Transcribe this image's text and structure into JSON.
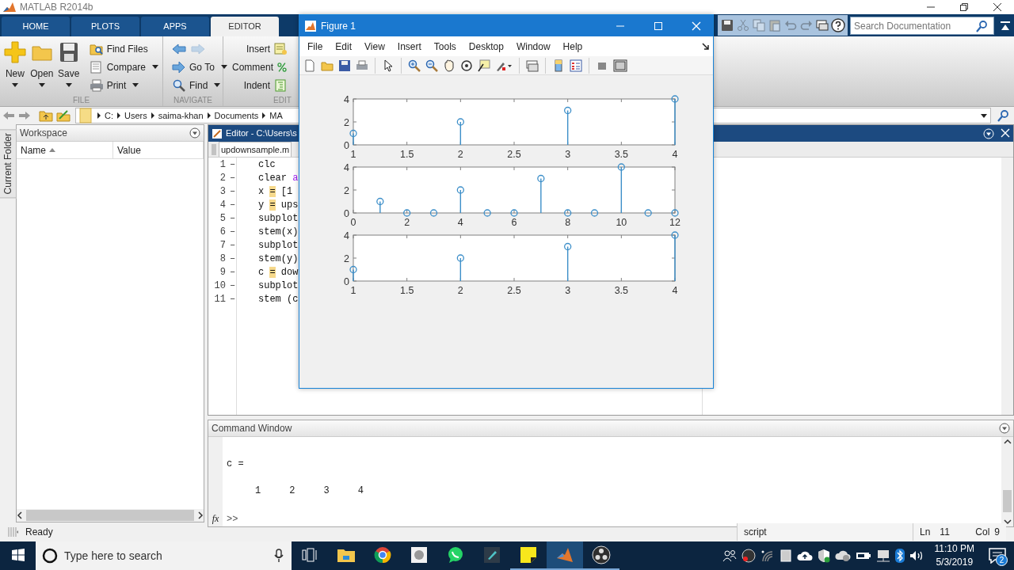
{
  "window": {
    "title": "MATLAB R2014b"
  },
  "toolstrip_tabs": [
    {
      "label": "HOME",
      "selected": false
    },
    {
      "label": "PLOTS",
      "selected": false
    },
    {
      "label": "APPS",
      "selected": false
    },
    {
      "label": "EDITOR",
      "selected": true
    }
  ],
  "quick_access": [
    {
      "disabled": false
    },
    {
      "disabled": true
    },
    {
      "disabled": true
    },
    {
      "disabled": true
    },
    {
      "disabled": true
    },
    {
      "disabled": true
    },
    {
      "disabled": false
    },
    {
      "disabled": false
    }
  ],
  "search": {
    "placeholder": "Search Documentation"
  },
  "ribbon_sections": [
    {
      "title": "FILE",
      "columns": [
        {
          "kind": "large",
          "label": "New",
          "dropdown": true
        },
        {
          "kind": "large",
          "label": "Open",
          "dropdown": true
        },
        {
          "kind": "large",
          "label": "Save",
          "dropdown": true
        },
        {
          "kind": "stack",
          "rows": [
            {
              "kind": "button",
              "label": "Find Files",
              "dropdown": false
            },
            {
              "kind": "button",
              "label": "Compare",
              "dropdown": true
            },
            {
              "kind": "button",
              "label": "Print",
              "dropdown": true
            }
          ]
        }
      ]
    },
    {
      "title": "NAVIGATE",
      "columns": [
        {
          "kind": "stack",
          "rows": [
            {
              "kind": "history",
              "back_disabled": false,
              "forward_disabled": true
            },
            {
              "kind": "button",
              "label": "Go To",
              "dropdown": true
            },
            {
              "kind": "button",
              "label": "Find",
              "dropdown": true
            }
          ]
        }
      ]
    },
    {
      "title": "EDIT",
      "columns": [
        {
          "kind": "stack",
          "rows": [
            {
              "kind": "trailing",
              "label": "Insert",
              "dropdown": false
            },
            {
              "kind": "trailing",
              "label": "Comment",
              "dropdown": false
            },
            {
              "kind": "trailing",
              "label": "Indent",
              "dropdown": false
            }
          ]
        }
      ]
    }
  ],
  "address_bar": {
    "path": [
      "C:",
      "Users",
      "saima-khan",
      "Documents",
      "MA"
    ]
  },
  "side_tab": {
    "label": "Current Folder"
  },
  "workspace": {
    "title": "Workspace",
    "columns": [
      {
        "label": "Name",
        "sorted": true
      },
      {
        "label": "Value",
        "sorted": false
      }
    ]
  },
  "editor": {
    "title": "Editor - C:\\Users\\s",
    "tabs": [
      {
        "label": "updownsample.m",
        "selected": true
      }
    ],
    "lines": [
      {
        "number": "1",
        "marker": "–",
        "code": [
          {
            "kind": "plain",
            "text": "clc"
          }
        ]
      },
      {
        "number": "2",
        "marker": "–",
        "code": [
          {
            "kind": "plain",
            "text": "clear "
          },
          {
            "kind": "string",
            "text": "a"
          }
        ]
      },
      {
        "number": "3",
        "marker": "–",
        "code": [
          {
            "kind": "plain",
            "text": "x "
          },
          {
            "kind": "warning",
            "text": "="
          },
          {
            "kind": "plain",
            "text": " [1"
          }
        ]
      },
      {
        "number": "4",
        "marker": "–",
        "code": [
          {
            "kind": "plain",
            "text": "y "
          },
          {
            "kind": "warning",
            "text": "="
          },
          {
            "kind": "plain",
            "text": " ups"
          }
        ]
      },
      {
        "number": "5",
        "marker": "–",
        "code": [
          {
            "kind": "plain",
            "text": "subplot"
          }
        ]
      },
      {
        "number": "6",
        "marker": "–",
        "code": [
          {
            "kind": "plain",
            "text": "stem(x)"
          }
        ]
      },
      {
        "number": "7",
        "marker": "–",
        "code": [
          {
            "kind": "plain",
            "text": "subplot"
          }
        ]
      },
      {
        "number": "8",
        "marker": "–",
        "code": [
          {
            "kind": "plain",
            "text": "stem(y)"
          }
        ]
      },
      {
        "number": "9",
        "marker": "–",
        "code": [
          {
            "kind": "plain",
            "text": "c "
          },
          {
            "kind": "warning",
            "text": "="
          },
          {
            "kind": "plain",
            "text": " dow"
          }
        ]
      },
      {
        "number": "10",
        "marker": "–",
        "code": [
          {
            "kind": "plain",
            "text": "subplot"
          }
        ]
      },
      {
        "number": "11",
        "marker": "–",
        "code": [
          {
            "kind": "plain",
            "text": "stem (c"
          }
        ]
      }
    ]
  },
  "command_window": {
    "title": "Command Window",
    "output": [
      "c =",
      "     1     2     3     4"
    ],
    "function_icon": "fx",
    "prompt": ">>"
  },
  "status_bar": {
    "status": "Ready",
    "file_type": "script",
    "line_label": "Ln",
    "line": "11",
    "column_label": "Col",
    "column": "9"
  },
  "figure": {
    "title": "Figure 1",
    "menu": [
      "File",
      "Edit",
      "View",
      "Insert",
      "Tools",
      "Desktop",
      "Window",
      "Help"
    ],
    "plots": [
      {
        "chart_data": {
          "type": "bar",
          "x": [
            1,
            2,
            3,
            4
          ],
          "series": [
            {
              "color": "#3d8fc9",
              "values": [
                1,
                2,
                3,
                4
              ]
            }
          ],
          "xlim": [
            1,
            4
          ],
          "ylim": [
            0,
            4
          ],
          "xticks": [
            1,
            1.5,
            2,
            2.5,
            3,
            3.5,
            4
          ],
          "yticks": [
            0,
            2,
            4
          ]
        }
      },
      {
        "chart_data": {
          "type": "bar",
          "x": [
            1,
            2,
            3,
            4,
            5,
            6,
            7,
            8,
            9,
            10,
            11,
            12
          ],
          "series": [
            {
              "color": "#3d8fc9",
              "values": [
                1,
                0,
                0,
                2,
                0,
                0,
                3,
                0,
                0,
                4,
                0,
                0
              ]
            }
          ],
          "xlim": [
            0,
            12
          ],
          "ylim": [
            0,
            4
          ],
          "xticks": [
            0,
            2,
            4,
            6,
            8,
            10,
            12
          ],
          "yticks": [
            0,
            2,
            4
          ]
        }
      },
      {
        "chart_data": {
          "type": "bar",
          "x": [
            1,
            2,
            3,
            4
          ],
          "series": [
            {
              "color": "#3d8fc9",
              "values": [
                1,
                2,
                3,
                4
              ]
            }
          ],
          "xlim": [
            1,
            4
          ],
          "ylim": [
            0,
            4
          ],
          "xticks": [
            1,
            1.5,
            2,
            2.5,
            3,
            3.5,
            4
          ],
          "yticks": [
            0,
            2,
            4
          ]
        }
      }
    ]
  },
  "taskbar": {
    "search_placeholder": "Type here to search",
    "apps": [
      {
        "running": false,
        "active": false
      },
      {
        "running": false,
        "active": false
      },
      {
        "running": false,
        "active": false
      },
      {
        "running": false,
        "active": false
      },
      {
        "running": false,
        "active": false
      },
      {
        "running": false,
        "active": false
      },
      {
        "running": true,
        "active": false
      },
      {
        "running": true,
        "active": true
      },
      {
        "running": true,
        "active": false
      }
    ],
    "clock": {
      "time": "11:10 PM",
      "date": "5/3/2019"
    },
    "notification_count": "2"
  }
}
